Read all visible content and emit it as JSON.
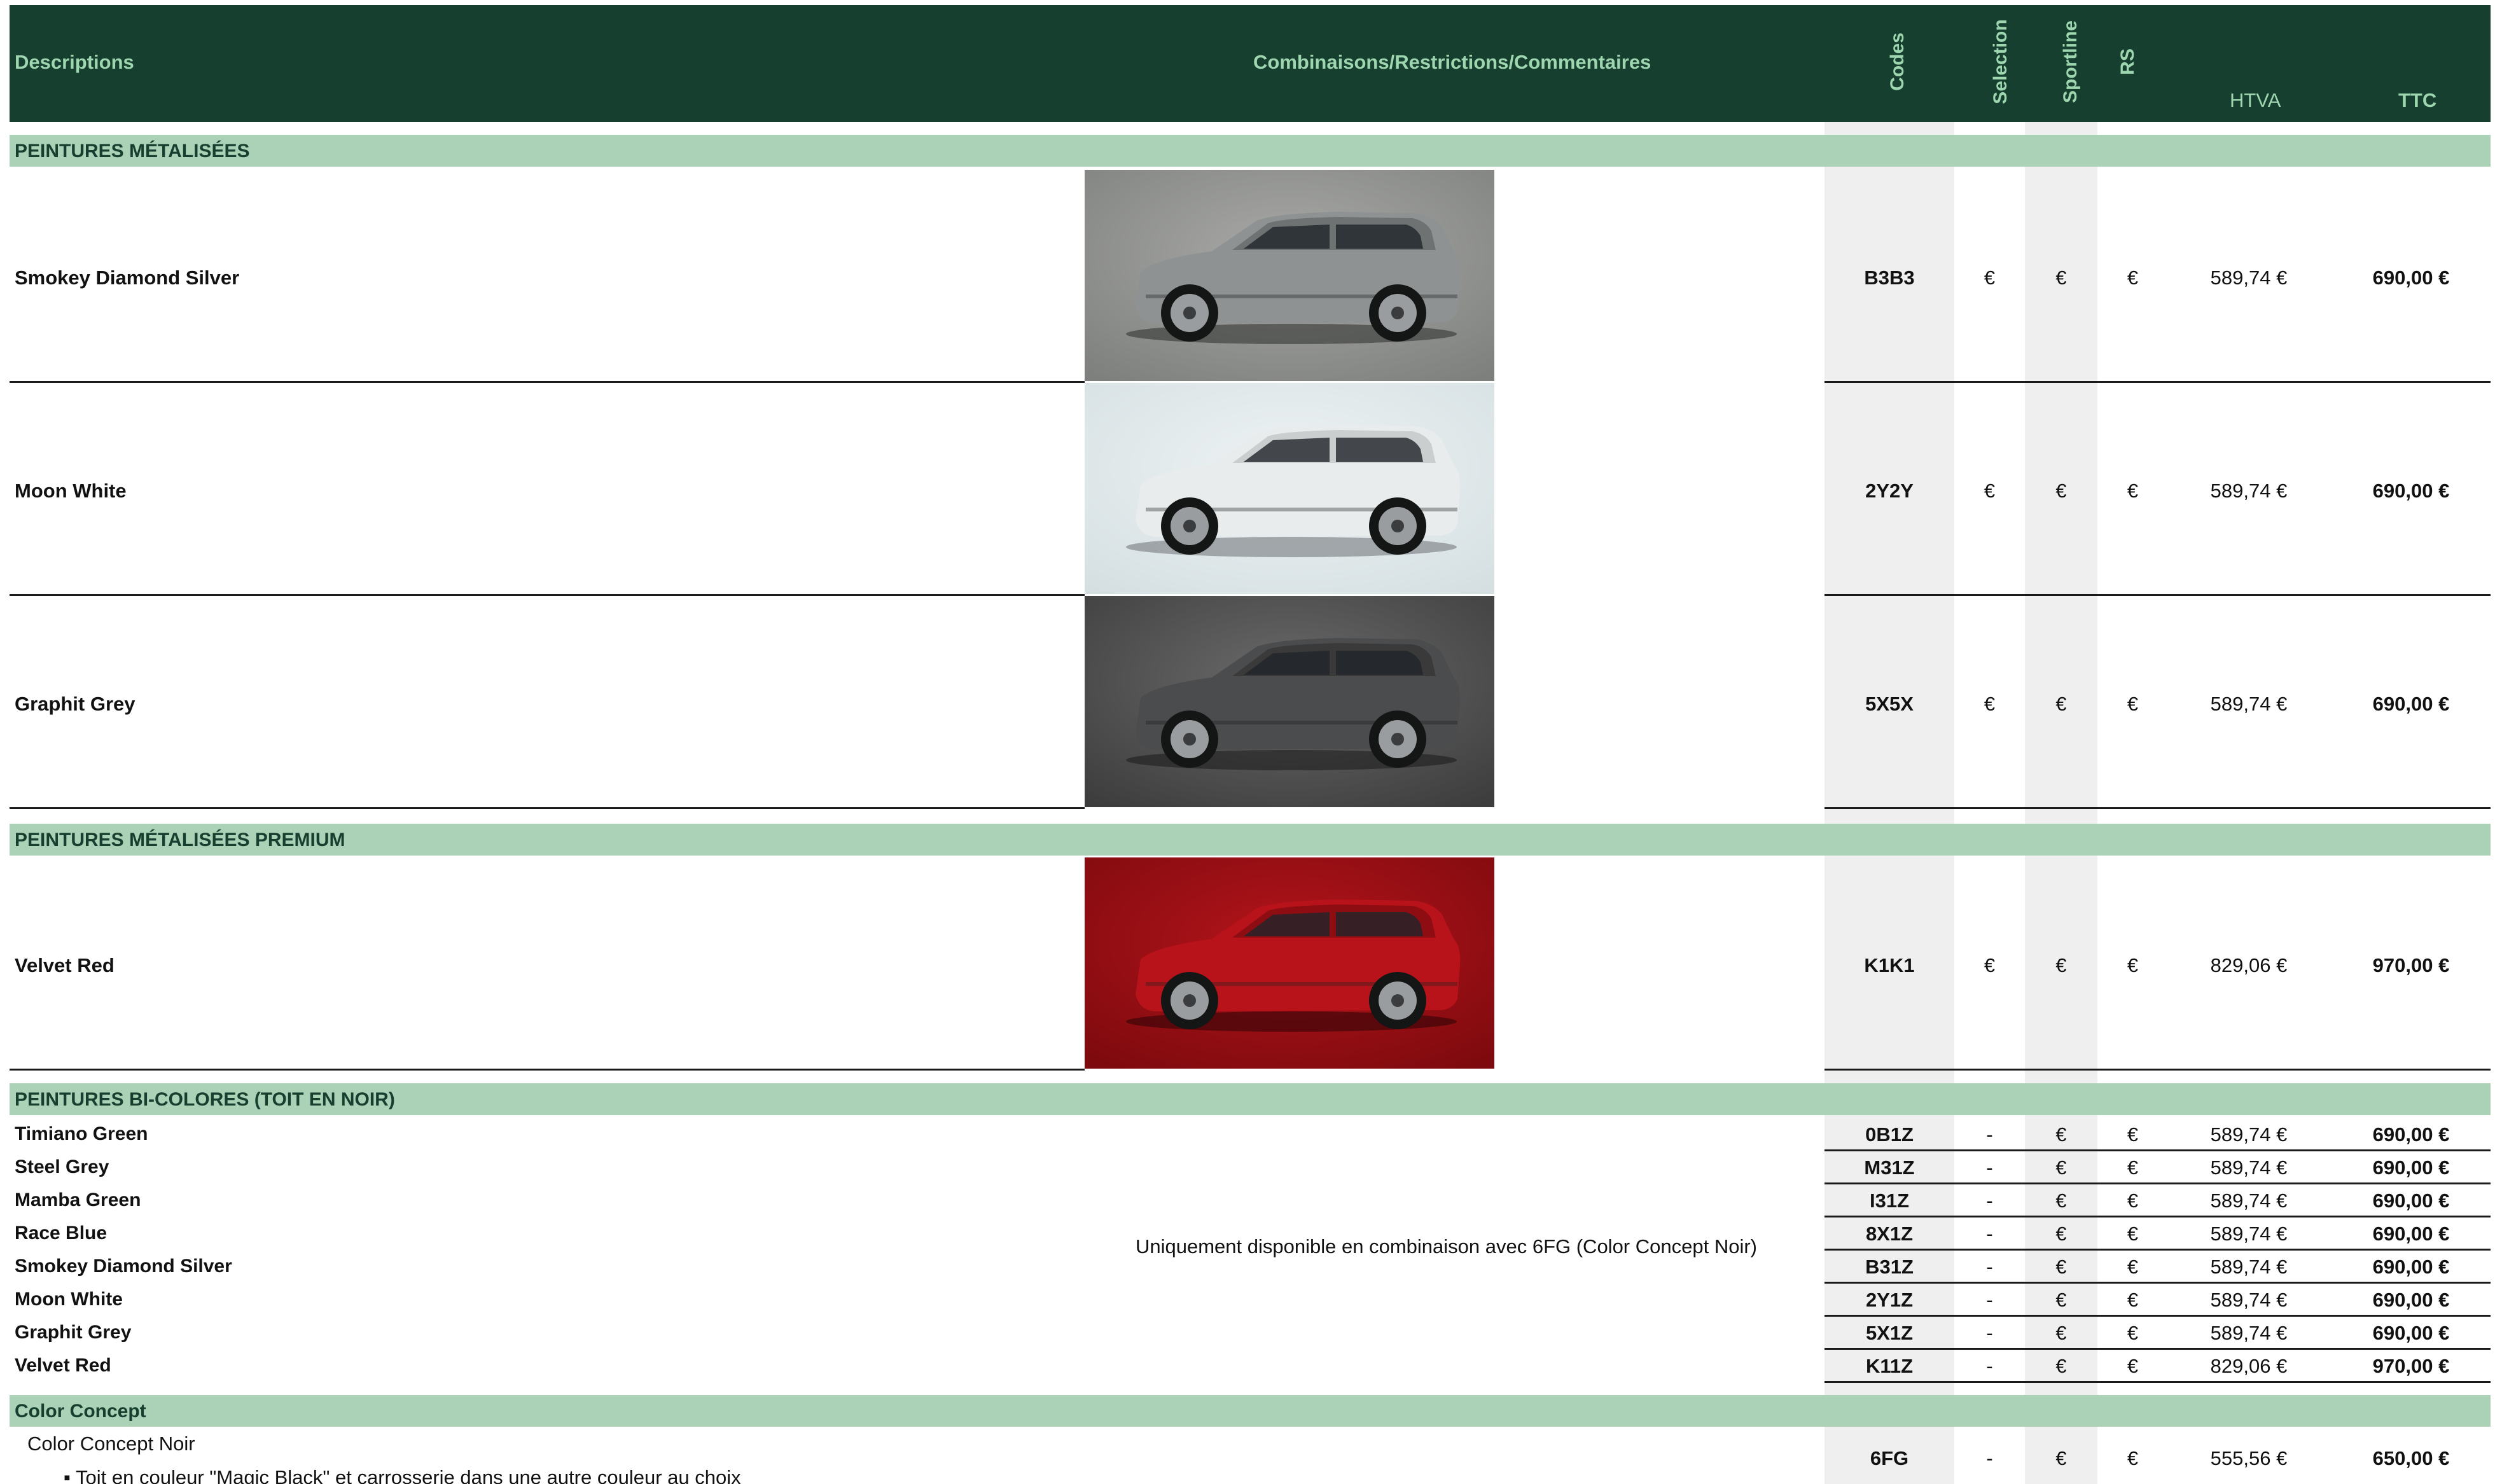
{
  "header": {
    "descriptions": "Descriptions",
    "combinaisons": "Combinaisons/Restrictions/Commentaires",
    "codes": "Codes",
    "selection": "Selection",
    "sportline": "Sportline",
    "rs": "RS",
    "htva": "HTVA",
    "ttc": "TTC"
  },
  "sections": {
    "metallic": "PEINTURES MÉTALISÉES",
    "premium": "PEINTURES MÉTALISÉES PREMIUM",
    "bicolor": "PEINTURES BI-COLORES (TOIT EN NOIR)",
    "color_concept": "Color Concept"
  },
  "colors": {
    "header_bg": "#173f2f",
    "header_text": "#9ed6b0",
    "section_bg": "#abd2b6",
    "section_text": "#173f2f",
    "grey_column": "#efefef"
  },
  "metallic_rows": [
    {
      "name": "Smokey Diamond Silver",
      "code": "B3B3",
      "selection": "€",
      "sportline": "€",
      "rs": "€",
      "htva": "589,74 €",
      "ttc": "690,00 €",
      "image": "car-silver"
    },
    {
      "name": "Moon White",
      "code": "2Y2Y",
      "selection": "€",
      "sportline": "€",
      "rs": "€",
      "htva": "589,74 €",
      "ttc": "690,00 €",
      "image": "car-white"
    },
    {
      "name": "Graphit Grey",
      "code": "5X5X",
      "selection": "€",
      "sportline": "€",
      "rs": "€",
      "htva": "589,74 €",
      "ttc": "690,00 €",
      "image": "car-grey"
    }
  ],
  "premium_rows": [
    {
      "name": "Velvet Red",
      "code": "K1K1",
      "selection": "€",
      "sportline": "€",
      "rs": "€",
      "htva": "829,06 €",
      "ttc": "970,00 €",
      "image": "car-red"
    }
  ],
  "bicolor_comment": "Uniquement disponible en combinaison avec 6FG (Color Concept Noir)",
  "bicolor_rows": [
    {
      "name": "Timiano Green",
      "code": "0B1Z",
      "selection": "-",
      "sportline": "€",
      "rs": "€",
      "htva": "589,74 €",
      "ttc": "690,00 €"
    },
    {
      "name": "Steel Grey",
      "code": "M31Z",
      "selection": "-",
      "sportline": "€",
      "rs": "€",
      "htva": "589,74 €",
      "ttc": "690,00 €"
    },
    {
      "name": "Mamba Green",
      "code": "I31Z",
      "selection": "-",
      "sportline": "€",
      "rs": "€",
      "htva": "589,74 €",
      "ttc": "690,00 €"
    },
    {
      "name": "Race Blue",
      "code": "8X1Z",
      "selection": "-",
      "sportline": "€",
      "rs": "€",
      "htva": "589,74 €",
      "ttc": "690,00 €"
    },
    {
      "name": "Smokey Diamond Silver",
      "code": "B31Z",
      "selection": "-",
      "sportline": "€",
      "rs": "€",
      "htva": "589,74 €",
      "ttc": "690,00 €"
    },
    {
      "name": "Moon White",
      "code": "2Y1Z",
      "selection": "-",
      "sportline": "€",
      "rs": "€",
      "htva": "589,74 €",
      "ttc": "690,00 €"
    },
    {
      "name": "Graphit Grey",
      "code": "5X1Z",
      "selection": "-",
      "sportline": "€",
      "rs": "€",
      "htva": "589,74 €",
      "ttc": "690,00 €"
    },
    {
      "name": "Velvet Red",
      "code": "K11Z",
      "selection": "-",
      "sportline": "€",
      "rs": "€",
      "htva": "829,06 €",
      "ttc": "970,00 €"
    }
  ],
  "color_concept": {
    "name": "Color Concept Noir",
    "bullet": "▪ Toit en couleur \"Magic Black\" et carrosserie dans une autre couleur au choix",
    "code": "6FG",
    "selection": "-",
    "sportline": "€",
    "rs": "€",
    "htva": "555,56 €",
    "ttc": "650,00 €"
  }
}
